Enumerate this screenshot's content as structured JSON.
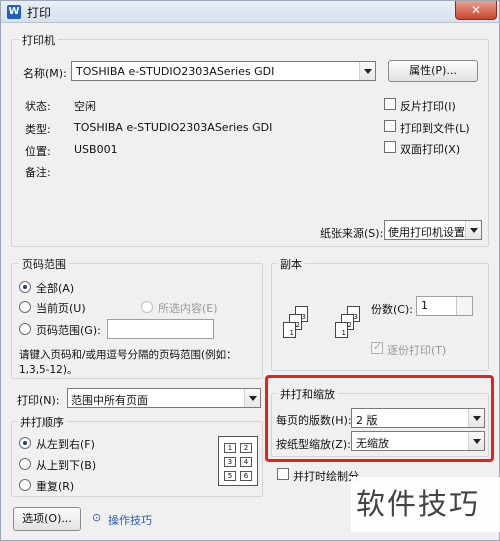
{
  "window": {
    "title": "打印",
    "app_icon": "W",
    "close_glyph": "✕"
  },
  "printer": {
    "group_label": "打印机",
    "name_label": "名称(M):",
    "name_value": "TOSHIBA e-STUDIO2303ASeries GDI",
    "properties_button": "属性(P)...",
    "status_label": "状态:",
    "status_value": "空闲",
    "type_label": "类型:",
    "type_value": "TOSHIBA e-STUDIO2303ASeries GDI",
    "location_label": "位置:",
    "location_value": "USB001",
    "comment_label": "备注:",
    "options": [
      "反片打印(I)",
      "打印到文件(L)",
      "双面打印(X)"
    ],
    "paper_source_label": "纸张来源(S):",
    "paper_source_value": "使用打印机设置"
  },
  "page_range": {
    "group_label": "页码范围",
    "all": "全部(A)",
    "current": "当前页(U)",
    "selection": "所选内容(E)",
    "range": "页码范围(G):",
    "hint_line1": "请键入页码和/或用逗号分隔的页码范围(例如：",
    "hint_line2": "1,3,5-12)。"
  },
  "copies": {
    "group_label": "副本",
    "count_label": "份数(C):",
    "count_value": "1",
    "collate": "逐份打印(T)",
    "page_numbers": [
      "1",
      "2",
      "3",
      "1",
      "2",
      "3"
    ]
  },
  "print_what": {
    "label": "打印(N):",
    "value": "范围中所有页面"
  },
  "order": {
    "group_label": "并打顺序",
    "left_to_right": "从左到右(F)",
    "top_to_bottom": "从上到下(B)",
    "repeat": "重复(R)",
    "grid_numbers": [
      "1",
      "2",
      "3",
      "4",
      "5",
      "6"
    ]
  },
  "zoom": {
    "group_label": "并打和缩放",
    "pages_per_sheet_label": "每页的版数(H):",
    "pages_per_sheet_value": "2 版",
    "scale_label": "按纸型缩放(Z):",
    "scale_value": "无缩放",
    "draw_border": "并打时绘制分"
  },
  "footer": {
    "options_button": "选项(O)...",
    "tips_link": "操作技巧",
    "tips_icon_glyph": "⊙"
  },
  "watermark": "软件技巧",
  "colors": {
    "highlight": "#e0251a",
    "link": "#2b5bb8"
  }
}
